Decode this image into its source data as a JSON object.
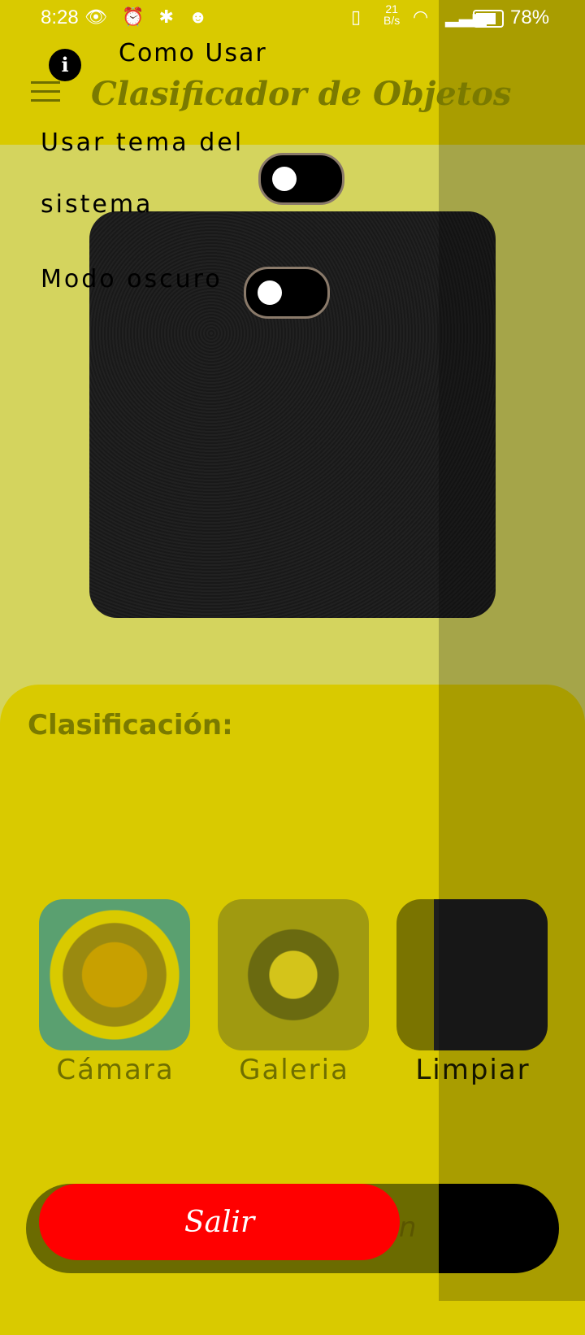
{
  "status_bar": {
    "time": "8:28",
    "left_icons": [
      "eye-icon",
      "alarm-icon",
      "bluetooth-icon",
      "app-icon"
    ],
    "left_glyphs": "👁 ⏰ ✱ ☻",
    "network_speed_value": "21",
    "network_speed_unit": "B/s",
    "battery": "78%"
  },
  "drawer": {
    "how_to_use": "Como Usar",
    "theme_label_line1": "Usar tema del",
    "theme_label_line2": "sistema",
    "dark_mode_label": "Modo oscuro"
  },
  "header": {
    "title": "Clasificador de Objetos"
  },
  "main": {
    "classification_title": "Clasificación:",
    "actions": [
      {
        "label": "Cámara"
      },
      {
        "label": "Galeria"
      },
      {
        "label": "Limpiar"
      }
    ],
    "pill_text": "en",
    "exit_label": "Salir"
  },
  "colors": {
    "primary": "#d9ca00",
    "exit": "#ff0000",
    "title": "#7a7a00"
  }
}
